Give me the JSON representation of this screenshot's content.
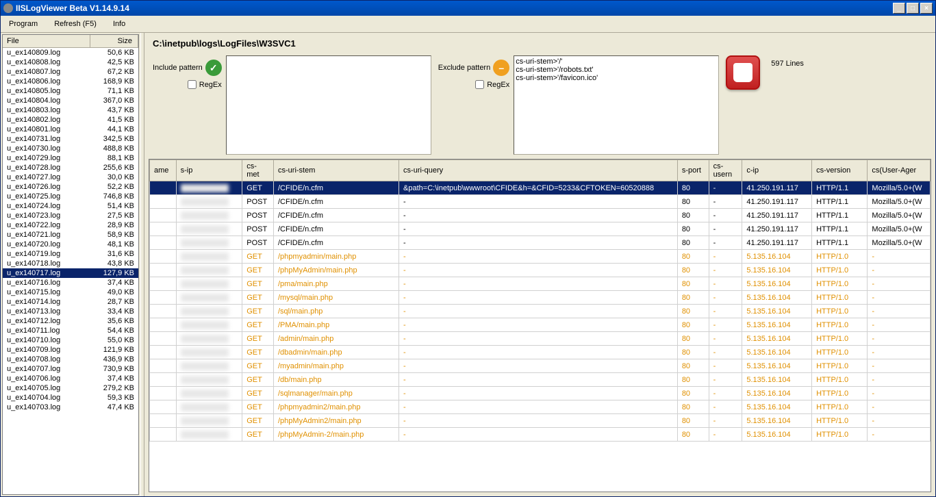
{
  "window": {
    "title": "IISLogViewer Beta V1.14.9.14"
  },
  "menu": {
    "program": "Program",
    "refresh": "Refresh (F5)",
    "info": "Info"
  },
  "file_panel": {
    "header_file": "File",
    "header_size": "Size",
    "selected": "u_ex140717.log",
    "files": [
      {
        "name": "u_ex140809.log",
        "size": "50,6 KB"
      },
      {
        "name": "u_ex140808.log",
        "size": "42,5 KB"
      },
      {
        "name": "u_ex140807.log",
        "size": "67,2 KB"
      },
      {
        "name": "u_ex140806.log",
        "size": "168,9 KB"
      },
      {
        "name": "u_ex140805.log",
        "size": "71,1 KB"
      },
      {
        "name": "u_ex140804.log",
        "size": "367,0 KB"
      },
      {
        "name": "u_ex140803.log",
        "size": "43,7 KB"
      },
      {
        "name": "u_ex140802.log",
        "size": "41,5 KB"
      },
      {
        "name": "u_ex140801.log",
        "size": "44,1 KB"
      },
      {
        "name": "u_ex140731.log",
        "size": "342,5 KB"
      },
      {
        "name": "u_ex140730.log",
        "size": "488,8 KB"
      },
      {
        "name": "u_ex140729.log",
        "size": "88,1 KB"
      },
      {
        "name": "u_ex140728.log",
        "size": "255,6 KB"
      },
      {
        "name": "u_ex140727.log",
        "size": "30,0 KB"
      },
      {
        "name": "u_ex140726.log",
        "size": "52,2 KB"
      },
      {
        "name": "u_ex140725.log",
        "size": "746,8 KB"
      },
      {
        "name": "u_ex140724.log",
        "size": "51,4 KB"
      },
      {
        "name": "u_ex140723.log",
        "size": "27,5 KB"
      },
      {
        "name": "u_ex140722.log",
        "size": "28,9 KB"
      },
      {
        "name": "u_ex140721.log",
        "size": "58,9 KB"
      },
      {
        "name": "u_ex140720.log",
        "size": "48,1 KB"
      },
      {
        "name": "u_ex140719.log",
        "size": "31,6 KB"
      },
      {
        "name": "u_ex140718.log",
        "size": "43,8 KB"
      },
      {
        "name": "u_ex140717.log",
        "size": "127,9 KB"
      },
      {
        "name": "u_ex140716.log",
        "size": "37,4 KB"
      },
      {
        "name": "u_ex140715.log",
        "size": "49,0 KB"
      },
      {
        "name": "u_ex140714.log",
        "size": "28,7 KB"
      },
      {
        "name": "u_ex140713.log",
        "size": "33,4 KB"
      },
      {
        "name": "u_ex140712.log",
        "size": "35,6 KB"
      },
      {
        "name": "u_ex140711.log",
        "size": "54,4 KB"
      },
      {
        "name": "u_ex140710.log",
        "size": "55,0 KB"
      },
      {
        "name": "u_ex140709.log",
        "size": "121,9 KB"
      },
      {
        "name": "u_ex140708.log",
        "size": "436,9 KB"
      },
      {
        "name": "u_ex140707.log",
        "size": "730,9 KB"
      },
      {
        "name": "u_ex140706.log",
        "size": "37,4 KB"
      },
      {
        "name": "u_ex140705.log",
        "size": "279,2 KB"
      },
      {
        "name": "u_ex140704.log",
        "size": "59,3 KB"
      },
      {
        "name": "u_ex140703.log",
        "size": "47,4 KB"
      }
    ]
  },
  "path": "C:\\inetpub\\logs\\LogFiles\\W3SVC1",
  "filters": {
    "include_label": "Include pattern",
    "exclude_label": "Exclude pattern",
    "regex_label": "RegEx",
    "include_value": "",
    "exclude_value": "cs-uri-stem>'/'\ncs-uri-stem>'/robots.txt'\ncs-uri-stem>'/favicon.ico'"
  },
  "lines_label": "597 Lines",
  "grid": {
    "columns": [
      "ame",
      "s-ip",
      "cs-met",
      "cs-uri-stem",
      "cs-uri-query",
      "s-port",
      "cs-usern",
      "c-ip",
      "cs-version",
      "cs(User-Ager"
    ],
    "rows": [
      {
        "sel": true,
        "sus": false,
        "method": "GET",
        "stem": "/CFIDE/n.cfm",
        "query": "&path=C:\\inetpub\\wwwroot\\CFIDE&h=&CFID=5233&CFTOKEN=60520888",
        "port": "80",
        "user": "-",
        "cip": "41.250.191.117",
        "ver": "HTTP/1.1",
        "ua": "Mozilla/5.0+(W"
      },
      {
        "sel": false,
        "sus": false,
        "method": "POST",
        "stem": "/CFIDE/n.cfm",
        "query": "-",
        "port": "80",
        "user": "-",
        "cip": "41.250.191.117",
        "ver": "HTTP/1.1",
        "ua": "Mozilla/5.0+(W"
      },
      {
        "sel": false,
        "sus": false,
        "method": "POST",
        "stem": "/CFIDE/n.cfm",
        "query": "-",
        "port": "80",
        "user": "-",
        "cip": "41.250.191.117",
        "ver": "HTTP/1.1",
        "ua": "Mozilla/5.0+(W"
      },
      {
        "sel": false,
        "sus": false,
        "method": "POST",
        "stem": "/CFIDE/n.cfm",
        "query": "-",
        "port": "80",
        "user": "-",
        "cip": "41.250.191.117",
        "ver": "HTTP/1.1",
        "ua": "Mozilla/5.0+(W"
      },
      {
        "sel": false,
        "sus": false,
        "method": "POST",
        "stem": "/CFIDE/n.cfm",
        "query": "-",
        "port": "80",
        "user": "-",
        "cip": "41.250.191.117",
        "ver": "HTTP/1.1",
        "ua": "Mozilla/5.0+(W"
      },
      {
        "sel": false,
        "sus": true,
        "method": "GET",
        "stem": "/phpmyadmin/main.php",
        "query": "-",
        "port": "80",
        "user": "-",
        "cip": "5.135.16.104",
        "ver": "HTTP/1.0",
        "ua": "-"
      },
      {
        "sel": false,
        "sus": true,
        "method": "GET",
        "stem": "/phpMyAdmin/main.php",
        "query": "-",
        "port": "80",
        "user": "-",
        "cip": "5.135.16.104",
        "ver": "HTTP/1.0",
        "ua": "-"
      },
      {
        "sel": false,
        "sus": true,
        "method": "GET",
        "stem": "/pma/main.php",
        "query": "-",
        "port": "80",
        "user": "-",
        "cip": "5.135.16.104",
        "ver": "HTTP/1.0",
        "ua": "-"
      },
      {
        "sel": false,
        "sus": true,
        "method": "GET",
        "stem": "/mysql/main.php",
        "query": "-",
        "port": "80",
        "user": "-",
        "cip": "5.135.16.104",
        "ver": "HTTP/1.0",
        "ua": "-"
      },
      {
        "sel": false,
        "sus": true,
        "method": "GET",
        "stem": "/sql/main.php",
        "query": "-",
        "port": "80",
        "user": "-",
        "cip": "5.135.16.104",
        "ver": "HTTP/1.0",
        "ua": "-"
      },
      {
        "sel": false,
        "sus": true,
        "method": "GET",
        "stem": "/PMA/main.php",
        "query": "-",
        "port": "80",
        "user": "-",
        "cip": "5.135.16.104",
        "ver": "HTTP/1.0",
        "ua": "-"
      },
      {
        "sel": false,
        "sus": true,
        "method": "GET",
        "stem": "/admin/main.php",
        "query": "-",
        "port": "80",
        "user": "-",
        "cip": "5.135.16.104",
        "ver": "HTTP/1.0",
        "ua": "-"
      },
      {
        "sel": false,
        "sus": true,
        "method": "GET",
        "stem": "/dbadmin/main.php",
        "query": "-",
        "port": "80",
        "user": "-",
        "cip": "5.135.16.104",
        "ver": "HTTP/1.0",
        "ua": "-"
      },
      {
        "sel": false,
        "sus": true,
        "method": "GET",
        "stem": "/myadmin/main.php",
        "query": "-",
        "port": "80",
        "user": "-",
        "cip": "5.135.16.104",
        "ver": "HTTP/1.0",
        "ua": "-"
      },
      {
        "sel": false,
        "sus": true,
        "method": "GET",
        "stem": "/db/main.php",
        "query": "-",
        "port": "80",
        "user": "-",
        "cip": "5.135.16.104",
        "ver": "HTTP/1.0",
        "ua": "-"
      },
      {
        "sel": false,
        "sus": true,
        "method": "GET",
        "stem": "/sqlmanager/main.php",
        "query": "-",
        "port": "80",
        "user": "-",
        "cip": "5.135.16.104",
        "ver": "HTTP/1.0",
        "ua": "-"
      },
      {
        "sel": false,
        "sus": true,
        "method": "GET",
        "stem": "/phpmyadmin2/main.php",
        "query": "-",
        "port": "80",
        "user": "-",
        "cip": "5.135.16.104",
        "ver": "HTTP/1.0",
        "ua": "-"
      },
      {
        "sel": false,
        "sus": true,
        "method": "GET",
        "stem": "/phpMyAdmin2/main.php",
        "query": "-",
        "port": "80",
        "user": "-",
        "cip": "5.135.16.104",
        "ver": "HTTP/1.0",
        "ua": "-"
      },
      {
        "sel": false,
        "sus": true,
        "method": "GET",
        "stem": "/phpMyAdmin-2/main.php",
        "query": "-",
        "port": "80",
        "user": "-",
        "cip": "5.135.16.104",
        "ver": "HTTP/1.0",
        "ua": "-"
      }
    ]
  }
}
